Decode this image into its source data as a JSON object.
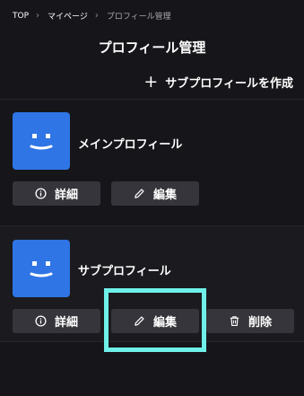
{
  "breadcrumb": {
    "items": [
      "TOP",
      "マイページ",
      "プロフィール管理"
    ]
  },
  "page_title": "プロフィール管理",
  "create_action": {
    "icon": "plus-icon",
    "label": "サブプロフィールを作成"
  },
  "profiles": [
    {
      "name": "メインプロフィール",
      "avatar_color": "#2f75e5",
      "buttons": {
        "detail": "詳細",
        "edit": "編集"
      }
    },
    {
      "name": "サブプロフィール",
      "avatar_color": "#2f75e5",
      "buttons": {
        "detail": "詳細",
        "edit": "編集",
        "delete": "削除"
      }
    }
  ],
  "colors": {
    "background": "#16161a",
    "button": "#35353b",
    "highlight": "#6ff0e8"
  }
}
